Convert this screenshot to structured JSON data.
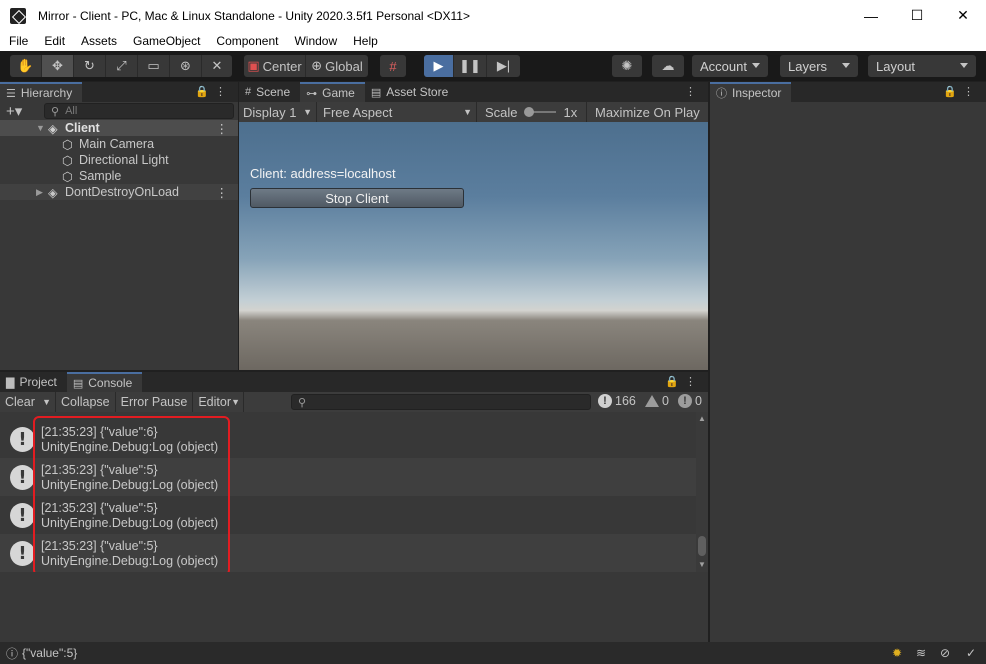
{
  "window": {
    "title": "Mirror - Client - PC, Mac & Linux Standalone - Unity 2020.3.5f1 Personal <DX11>",
    "minimize": "—",
    "maximize": "☐",
    "close": "✕"
  },
  "menu": [
    "File",
    "Edit",
    "Assets",
    "GameObject",
    "Component",
    "Window",
    "Help"
  ],
  "toolbar": {
    "pivot_label": "Center",
    "space_label": "Global",
    "account_label": "Account",
    "layers_label": "Layers",
    "layout_label": "Layout",
    "play_active": true
  },
  "hierarchy": {
    "tab_label": "Hierarchy",
    "search_placeholder": "All",
    "items": [
      {
        "label": "Client",
        "depth": 0,
        "expanded": true,
        "selected": true,
        "icon": "unity-scene-icon"
      },
      {
        "label": "Main Camera",
        "depth": 1,
        "icon": "gameobject-cube-icon"
      },
      {
        "label": "Directional Light",
        "depth": 1,
        "icon": "gameobject-cube-icon"
      },
      {
        "label": "Sample",
        "depth": 1,
        "icon": "gameobject-cube-icon"
      },
      {
        "label": "DontDestroyOnLoad",
        "depth": 0,
        "expanded": false,
        "icon": "unity-scene-icon"
      }
    ]
  },
  "center_tabs": [
    {
      "label": "Scene",
      "icon": "grid-icon"
    },
    {
      "label": "Game",
      "icon": "gamepad-icon",
      "active": true
    },
    {
      "label": "Asset Store",
      "icon": "bag-icon"
    }
  ],
  "game_view": {
    "display": "Display 1",
    "aspect": "Free Aspect",
    "scale_label": "Scale",
    "scale_value": "1x",
    "maximize_label": "Maximize On Play",
    "client_label": "Client: address=localhost",
    "stop_button": "Stop Client"
  },
  "inspector": {
    "tab_label": "Inspector"
  },
  "bottom_tabs": [
    {
      "label": "Project",
      "icon": "folder-icon"
    },
    {
      "label": "Console",
      "icon": "console-icon",
      "active": true
    }
  ],
  "console": {
    "clear": "Clear",
    "collapse": "Collapse",
    "error_pause": "Error Pause",
    "editor": "Editor",
    "counts": {
      "log": "166",
      "warning": "0",
      "error": "0"
    },
    "entries": [
      {
        "line1": "[21:35:23] {\"value\":6}",
        "line2": "UnityEngine.Debug:Log (object)"
      },
      {
        "line1": "[21:35:23] {\"value\":5}",
        "line2": "UnityEngine.Debug:Log (object)"
      },
      {
        "line1": "[21:35:23] {\"value\":5}",
        "line2": "UnityEngine.Debug:Log (object)"
      },
      {
        "line1": "[21:35:23] {\"value\":5}",
        "line2": "UnityEngine.Debug:Log (object)"
      }
    ],
    "highlight_color": "#e21c21"
  },
  "status": {
    "message": "{\"value\":5}"
  },
  "colors": {
    "accent": "#4a6ea0",
    "panel": "#383838",
    "tabstrip": "#282828"
  }
}
